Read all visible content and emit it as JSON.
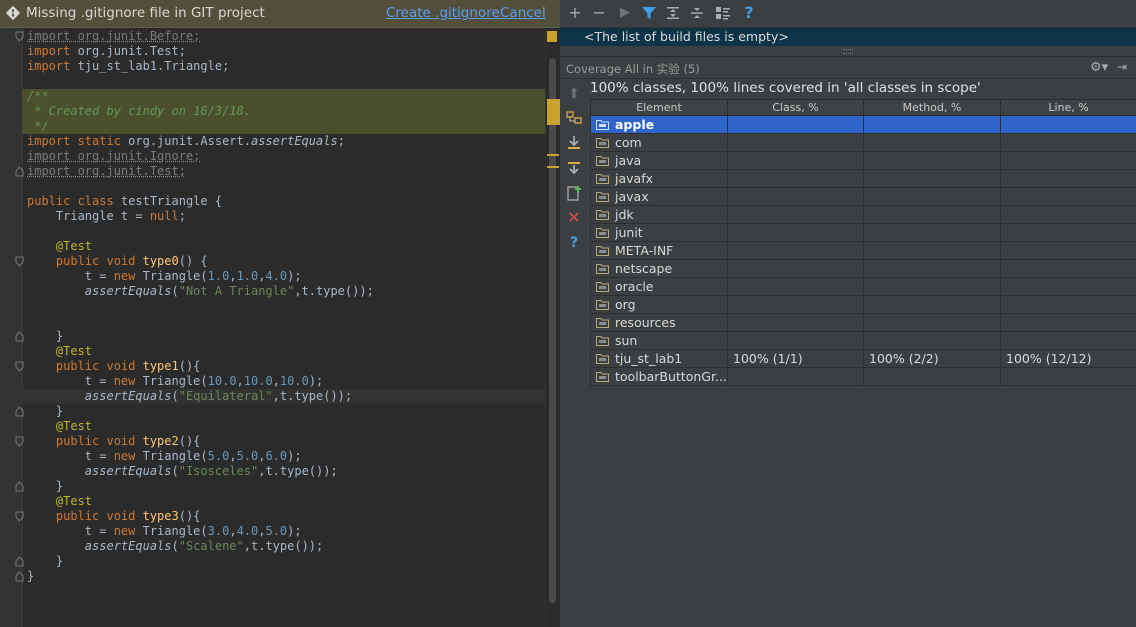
{
  "notification": {
    "text": "Missing .gitignore file in GIT project",
    "create_link": "Create .gitignore",
    "cancel_link": "Cancel"
  },
  "editor": {
    "lines": [
      [
        [
          "unused",
          "import org.junit.Before;"
        ]
      ],
      [
        [
          "kw",
          "import "
        ],
        [
          "",
          "org.junit.Test;"
        ]
      ],
      [
        [
          "kw",
          "import "
        ],
        [
          "",
          "tju_st_lab1.Triangle;"
        ]
      ],
      [],
      [
        [
          "cmt",
          "/**"
        ]
      ],
      [
        [
          "cmt",
          " * Created by cindy on 16/3/18."
        ]
      ],
      [
        [
          "cmt",
          " */"
        ]
      ],
      [
        [
          "kw",
          "import static "
        ],
        [
          "",
          "org.junit.Assert."
        ],
        [
          "it",
          "assertEquals"
        ],
        [
          "",
          ";"
        ]
      ],
      [
        [
          "unused",
          "import org.junit.Ignore;"
        ]
      ],
      [
        [
          "unused",
          "import org.junit.Test;"
        ]
      ],
      [],
      [
        [
          "kw",
          "public class "
        ],
        [
          "",
          "testTriangle {"
        ]
      ],
      [
        [
          "",
          "    Triangle t = "
        ],
        [
          "kw",
          "null"
        ],
        [
          "",
          ";"
        ]
      ],
      [],
      [
        [
          "ann",
          "    @Test"
        ]
      ],
      [
        [
          "kw",
          "    public void "
        ],
        [
          "fn",
          "type0"
        ],
        [
          "",
          "() {"
        ]
      ],
      [
        [
          "",
          "        t = "
        ],
        [
          "kw",
          "new "
        ],
        [
          "",
          "Triangle("
        ],
        [
          "num",
          "1.0"
        ],
        [
          "",
          ","
        ],
        [
          "num",
          "1.0"
        ],
        [
          "",
          ","
        ],
        [
          "num",
          "4.0"
        ],
        [
          "",
          ");"
        ]
      ],
      [
        [
          "",
          "        "
        ],
        [
          "it",
          "assertEquals"
        ],
        [
          "",
          "("
        ],
        [
          "str",
          "\"Not A Triangle\""
        ],
        [
          "",
          ",t.type());"
        ]
      ],
      [],
      [],
      [
        [
          "",
          "    }"
        ]
      ],
      [
        [
          "ann",
          "    @Test"
        ]
      ],
      [
        [
          "kw",
          "    public void "
        ],
        [
          "fn",
          "type1"
        ],
        [
          "",
          "(){"
        ]
      ],
      [
        [
          "",
          "        t = "
        ],
        [
          "kw",
          "new "
        ],
        [
          "",
          "Triangle("
        ],
        [
          "num",
          "10.0"
        ],
        [
          "",
          ","
        ],
        [
          "num",
          "10.0"
        ],
        [
          "",
          ","
        ],
        [
          "num",
          "10.0"
        ],
        [
          "",
          ");"
        ]
      ],
      [
        [
          "",
          "        "
        ],
        [
          "it",
          "assertEquals"
        ],
        [
          "",
          "("
        ],
        [
          "str",
          "\"Equilateral\""
        ],
        [
          "",
          ",t.type());"
        ]
      ],
      [
        [
          "",
          "    }"
        ]
      ],
      [
        [
          "ann",
          "    @Test"
        ]
      ],
      [
        [
          "kw",
          "    public void "
        ],
        [
          "fn",
          "type2"
        ],
        [
          "",
          "(){"
        ]
      ],
      [
        [
          "",
          "        t = "
        ],
        [
          "kw",
          "new "
        ],
        [
          "",
          "Triangle("
        ],
        [
          "num",
          "5.0"
        ],
        [
          "",
          ","
        ],
        [
          "num",
          "5.0"
        ],
        [
          "",
          ","
        ],
        [
          "num",
          "6.0"
        ],
        [
          "",
          ");"
        ]
      ],
      [
        [
          "",
          "        "
        ],
        [
          "it",
          "assertEquals"
        ],
        [
          "",
          "("
        ],
        [
          "str",
          "\"Isosceles\""
        ],
        [
          "",
          ",t.type());"
        ]
      ],
      [
        [
          "",
          "    }"
        ]
      ],
      [
        [
          "ann",
          "    @Test"
        ]
      ],
      [
        [
          "kw",
          "    public void "
        ],
        [
          "fn",
          "type3"
        ],
        [
          "",
          "(){"
        ]
      ],
      [
        [
          "",
          "        t = "
        ],
        [
          "kw",
          "new "
        ],
        [
          "",
          "Triangle("
        ],
        [
          "num",
          "3.0"
        ],
        [
          "",
          ","
        ],
        [
          "num",
          "4.0"
        ],
        [
          "",
          ","
        ],
        [
          "num",
          "5.0"
        ],
        [
          "",
          ");"
        ]
      ],
      [
        [
          "",
          "        "
        ],
        [
          "it",
          "assertEquals"
        ],
        [
          "",
          "("
        ],
        [
          "str",
          "\"Scalene\""
        ],
        [
          "",
          ",t.type());"
        ]
      ],
      [
        [
          "",
          "    }"
        ]
      ],
      [
        [
          "",
          "}"
        ]
      ]
    ]
  },
  "build_panel": {
    "toolbar": [
      "plus-icon",
      "minus-icon",
      "run-icon",
      "filter-icon",
      "expand-all-icon",
      "collapse-all-icon",
      "properties-icon",
      "help-icon"
    ],
    "empty_message": "<The list of build files is empty>"
  },
  "coverage": {
    "header_title": "Coverage All in 实验 (5)",
    "summary": "100% classes, 100% lines covered in 'all classes in scope'",
    "columns": [
      "Element",
      "Class, %",
      "Method, %",
      "Line, %"
    ],
    "rows": [
      {
        "name": "apple",
        "class": "",
        "method": "",
        "line": "",
        "selected": true
      },
      {
        "name": "com",
        "class": "",
        "method": "",
        "line": ""
      },
      {
        "name": "java",
        "class": "",
        "method": "",
        "line": ""
      },
      {
        "name": "javafx",
        "class": "",
        "method": "",
        "line": ""
      },
      {
        "name": "javax",
        "class": "",
        "method": "",
        "line": ""
      },
      {
        "name": "jdk",
        "class": "",
        "method": "",
        "line": ""
      },
      {
        "name": "junit",
        "class": "",
        "method": "",
        "line": ""
      },
      {
        "name": "META-INF",
        "class": "",
        "method": "",
        "line": ""
      },
      {
        "name": "netscape",
        "class": "",
        "method": "",
        "line": ""
      },
      {
        "name": "oracle",
        "class": "",
        "method": "",
        "line": ""
      },
      {
        "name": "org",
        "class": "",
        "method": "",
        "line": ""
      },
      {
        "name": "resources",
        "class": "",
        "method": "",
        "line": ""
      },
      {
        "name": "sun",
        "class": "",
        "method": "",
        "line": ""
      },
      {
        "name": "tju_st_lab1",
        "class": "100% (1/1)",
        "method": "100% (2/2)",
        "line": "100% (12/12)"
      },
      {
        "name": "toolbarButtonGr...",
        "class": "",
        "method": "",
        "line": ""
      }
    ]
  },
  "colors": {
    "accent_selection": "#2f65ca",
    "notification_bg": "#52503a",
    "link": "#589df6"
  }
}
